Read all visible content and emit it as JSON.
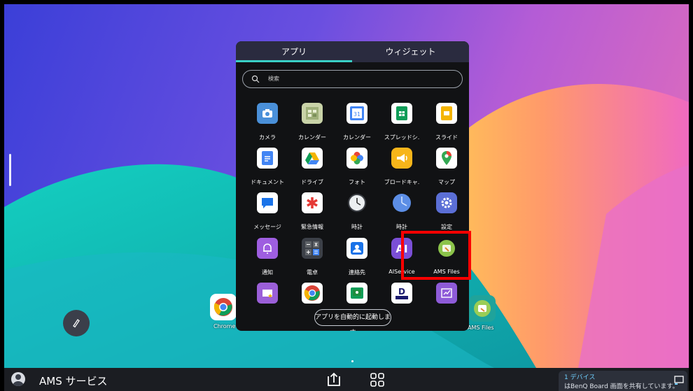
{
  "drawer": {
    "tabs": [
      "アプリ",
      "ウィジェット"
    ],
    "search_placeholder": "検索",
    "apps": [
      {
        "label": "カメラ",
        "icon": "camera-icon"
      },
      {
        "label": "カレンダー",
        "icon": "calendar-icon"
      },
      {
        "label": "カレンダー",
        "icon": "google-calendar-icon"
      },
      {
        "label": "スプレッドシ.",
        "icon": "sheets-icon"
      },
      {
        "label": "スライド",
        "icon": "slides-icon"
      },
      {
        "label": "ドキュメント",
        "icon": "docs-icon"
      },
      {
        "label": "ドライブ",
        "icon": "drive-icon"
      },
      {
        "label": "フォト",
        "icon": "photos-icon"
      },
      {
        "label": "ブロードキャ.",
        "icon": "broadcast-icon"
      },
      {
        "label": "マップ",
        "icon": "maps-icon"
      },
      {
        "label": "メッセージ",
        "icon": "messages-icon"
      },
      {
        "label": "緊急情報",
        "icon": "emergency-icon"
      },
      {
        "label": "時計",
        "icon": "clock-icon"
      },
      {
        "label": "時計",
        "icon": "clock-blue-icon"
      },
      {
        "label": "設定",
        "icon": "settings-icon"
      },
      {
        "label": "通知",
        "icon": "notification-icon"
      },
      {
        "label": "電卓",
        "icon": "calculator-icon"
      },
      {
        "label": "連絡先",
        "icon": "contacts-icon"
      },
      {
        "label": "AIService",
        "icon": "ai-service-icon"
      },
      {
        "label": "AMS Files",
        "icon": "ams-files-icon"
      }
    ],
    "launch_button": "アプリを自動的に起動します"
  },
  "desktop": {
    "dock": [
      {
        "label": "Chrome",
        "icon": "chrome-icon"
      },
      {
        "label": "AMS Files",
        "icon": "ams-files-icon"
      }
    ]
  },
  "taskbar": {
    "user": "AMS サービス",
    "share_line1": "1 デバイス",
    "share_line2": "はBenQ Board 画面を共有しています。"
  },
  "colors": {
    "accent": "#3ad0c5",
    "highlight": "#ff0000",
    "drawer_bg": "#111214",
    "tab_bg": "#2a2b3f"
  }
}
